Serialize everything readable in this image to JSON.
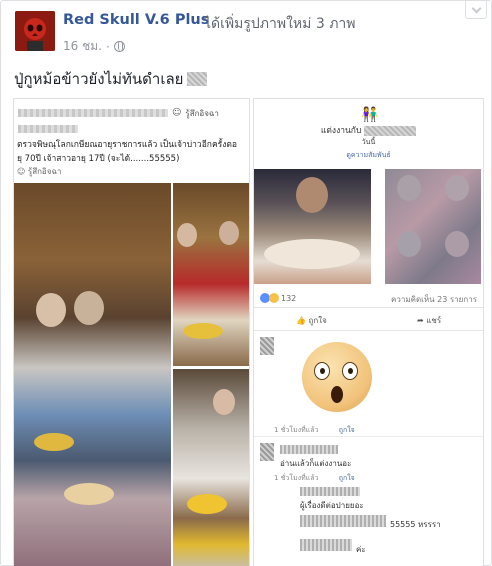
{
  "post": {
    "author": "Red Skull V.6 Plus",
    "action": "ได้เพิ่มรูปภาพใหม่ 3 ภาพ",
    "time": "16 ชม.",
    "privacy_icon": "globe-icon",
    "status_text": "ปู่กูหม้อข้าวยังไม่ทันดำเลย"
  },
  "left_screenshot": {
    "header_text": "รู้สึกอิจฉา",
    "line1": "ตรวจพิษณุโลกเกษียณอายุราชการแล้ว เป็นเจ้าบ่าวอีกครั้งตอ",
    "line2": "ยุ 70ปี เจ้าสาวอายุ 17ปี (จะได้.......55555)",
    "tag": "รู้สึกอิจฉา"
  },
  "right_screenshot": {
    "title_prefix": "แต่งงานกับ",
    "date": "วันนี้",
    "link": "ดูความสัมพันธ์",
    "reaction_count": "132",
    "comment_count": "ความคิดเห็น 23 รายการ",
    "like_label": "ถูกใจ",
    "share_label": "แชร์",
    "comments": [
      {
        "time": "1 ชั่วโมงที่แล้ว",
        "like": "ถูกใจ"
      },
      {
        "time": "1 ชั่วโมงที่แล้ว",
        "like": "ถูกใจ",
        "text": "อ่านแล้วก็แต่งงานอะ"
      },
      {
        "text": "ผู้เรื่องดีต่อปายยอะ"
      },
      {
        "text": "55555 หรรรา"
      },
      {
        "text": "ค่ะ"
      }
    ]
  },
  "colors": {
    "link_blue": "#365899",
    "meta_gray": "#90949c"
  }
}
